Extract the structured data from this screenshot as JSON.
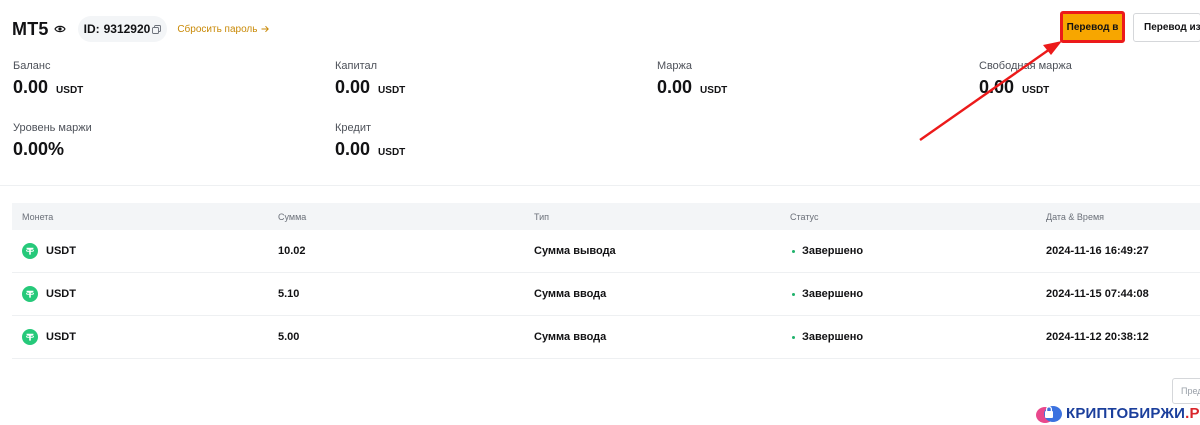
{
  "header": {
    "title": "MT5",
    "id_label": "ID:",
    "id_value": "9312920",
    "reset_password": "Сбросить пароль"
  },
  "actions": {
    "transfer_in": "Перевод в",
    "transfer_out": "Перевод из"
  },
  "stats": [
    {
      "label": "Баланс",
      "value": "0.00",
      "unit": "USDT"
    },
    {
      "label": "Капитал",
      "value": "0.00",
      "unit": "USDT"
    },
    {
      "label": "Маржа",
      "value": "0.00",
      "unit": "USDT"
    },
    {
      "label": "Свободная маржа",
      "value": "0.00",
      "unit": "USDT"
    },
    {
      "label": "Уровень маржи",
      "value": "0.00%",
      "unit": ""
    },
    {
      "label": "Кредит",
      "value": "0.00",
      "unit": "USDT"
    }
  ],
  "table": {
    "columns": [
      "Монета",
      "Сумма",
      "Тип",
      "Статус",
      "Дата & Время"
    ],
    "rows": [
      {
        "coin": "USDT",
        "amount": "10.02",
        "type": "Сумма вывода",
        "status": "Завершено",
        "datetime": "2024-11-16 16:49:27"
      },
      {
        "coin": "USDT",
        "amount": "5.10",
        "type": "Сумма ввода",
        "status": "Завершено",
        "datetime": "2024-11-15 07:44:08"
      },
      {
        "coin": "USDT",
        "amount": "5.00",
        "type": "Сумма ввода",
        "status": "Завершено",
        "datetime": "2024-11-12 20:38:12"
      }
    ]
  },
  "pagination": {
    "prev_label": "Пред"
  },
  "watermark": {
    "text": "КРИПТОБИРЖИ",
    "suffix": ".РФ"
  },
  "colors": {
    "accent": "#f7a600",
    "highlight_border": "#ec1a1a",
    "status_success": "#20b26c",
    "tether": "#26c97a",
    "link": "#c98a08"
  },
  "icons": {
    "visibility": "eye-icon",
    "copy": "copy-icon",
    "reset_arrow": "arrow-right-icon",
    "coin": "tether-icon",
    "status": "status-dot-icon"
  }
}
